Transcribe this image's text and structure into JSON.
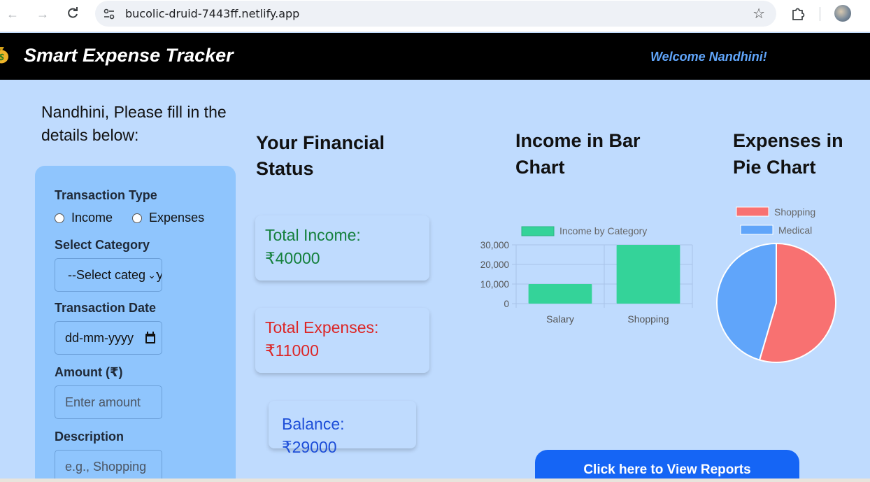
{
  "browser": {
    "url": "bucolic-druid-7443ff.netlify.app"
  },
  "header": {
    "title": "Smart Expense Tracker",
    "welcome": "Welcome Nandhini!"
  },
  "form": {
    "prompt": "Nandhini, Please fill in the details below:",
    "transaction_type_label": "Transaction Type",
    "type_options": [
      "Income",
      "Expenses"
    ],
    "category_label": "Select Category",
    "category_value": "--Select category--",
    "date_label": "Transaction Date",
    "date_placeholder": "dd-mm-yyyy",
    "amount_label": "Amount (₹)",
    "amount_placeholder": "Enter amount",
    "description_label": "Description",
    "description_placeholder": "e.g., Shopping"
  },
  "status": {
    "title": "Your Financial Status",
    "income": "Total Income: ₹40000",
    "expenses": "Total Expenses: ₹11000",
    "balance": "Balance: ₹29000"
  },
  "bar_section": {
    "title": "Income in Bar Chart"
  },
  "pie_section": {
    "title": "Expenses in Pie Chart"
  },
  "report_button": "Click here to View Reports",
  "colors": {
    "income_bar": "#34d399",
    "shopping_slice": "#f87171",
    "medical_slice": "#60a5fa",
    "income_text": "#15803d",
    "expenses_text": "#dc2626",
    "balance_text": "#1d4ed8",
    "button": "#1565f5"
  },
  "chart_data": [
    {
      "type": "bar",
      "categories": [
        "Salary",
        "Shopping"
      ],
      "series": [
        {
          "name": "Income by Category",
          "values": [
            10000,
            30000
          ]
        }
      ],
      "yticks": [
        "30,000",
        "20,000",
        "10,000",
        "0"
      ],
      "ylim": [
        0,
        30000
      ],
      "grid": true,
      "legend": "top"
    },
    {
      "type": "pie",
      "labels": [
        "Shopping",
        "Medical"
      ],
      "values": [
        6000,
        5000
      ],
      "legend": "top"
    }
  ]
}
